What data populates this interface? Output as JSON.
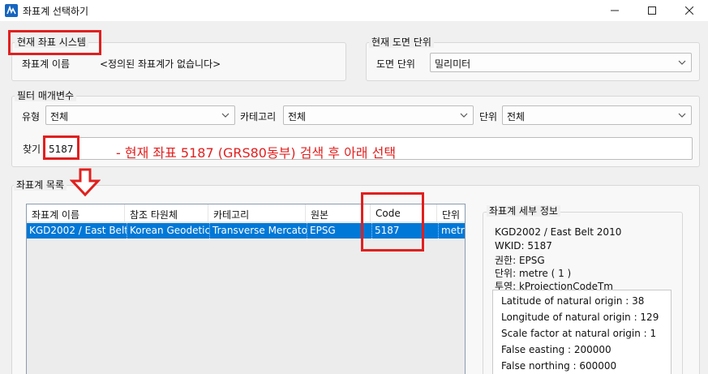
{
  "window": {
    "title": "좌표계 선택하기",
    "controls": [
      "minimize-icon",
      "maximize-icon",
      "close-icon"
    ]
  },
  "current_system": {
    "group_title": "현재 좌표 시스템",
    "name_label": "좌표계 이름",
    "name_value": "<정의된 좌표계가 없습니다>"
  },
  "current_unit": {
    "group_title": "현재 도면 단위",
    "unit_label": "도면 단위",
    "unit_value": "밀리미터"
  },
  "filter": {
    "group_title": "필터 매개변수",
    "type_label": "유형",
    "type_value": "전체",
    "category_label": "카테고리",
    "category_value": "전체",
    "unit_label": "단위",
    "unit_value": "전체",
    "search_label": "찾기",
    "search_value": "5187"
  },
  "annotation": {
    "text": "- 현재 좌표  5187 (GRS80동부) 검색 후 아래 선택"
  },
  "list": {
    "group_title": "좌표계 목록",
    "columns": [
      "좌표계 이름",
      "참조 타원체",
      "카테고리",
      "원본",
      "Code",
      "단위"
    ],
    "rows": [
      [
        "KGD2002 / East Belt",
        "Korean Geodetic",
        "Transverse Mercator",
        "EPSG",
        "5187",
        "metre"
      ]
    ]
  },
  "details": {
    "group_title": "좌표계 세부 정보",
    "lines": [
      "KGD2002 / East Belt 2010",
      "WKID:  5187",
      "권한:  EPSG",
      "단위:  metre ( 1 )",
      "투영:  kProjectionCodeTm"
    ],
    "params": [
      "Latitude of natural origin  :  38",
      "Longitude of natural origin  :  129",
      "Scale factor at natural origin  :  1",
      "False easting  :  200000",
      "False northing  :  600000"
    ]
  },
  "colors": {
    "accent": "#0078d7",
    "annotation": "#e0201f"
  }
}
